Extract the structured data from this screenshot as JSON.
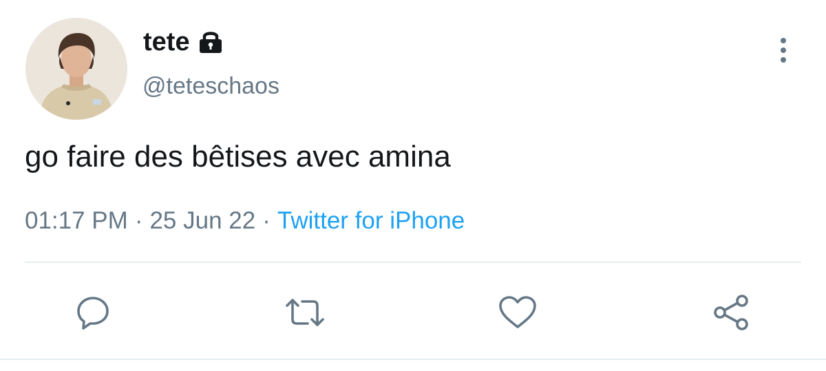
{
  "tweet": {
    "author": {
      "display_name": "tete",
      "handle": "@teteschaos",
      "protected_icon": "lock-icon"
    },
    "text": "go faire des bêtises avec amina",
    "meta": {
      "time": "01:17 PM",
      "separator": "·",
      "date": "25 Jun 22",
      "source": "Twitter for iPhone"
    },
    "actions": [
      {
        "name": "reply",
        "icon": "comment-icon"
      },
      {
        "name": "retweet",
        "icon": "retweet-icon"
      },
      {
        "name": "like",
        "icon": "heart-icon"
      },
      {
        "name": "share",
        "icon": "share-icon"
      }
    ],
    "menu_icon": "more-vertical-icon"
  },
  "colors": {
    "text_primary": "#14171a",
    "text_secondary": "#657786",
    "link_blue": "#1da1f2",
    "divider": "#e6ecf0"
  }
}
